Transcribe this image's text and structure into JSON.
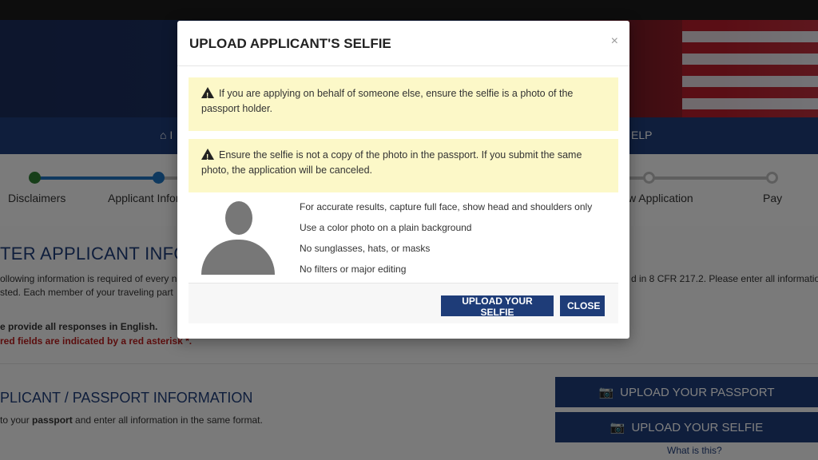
{
  "nav": {
    "home_fragment": "⌂ I",
    "help_fragment": "ELP"
  },
  "steps": [
    {
      "label": "Disclaimers"
    },
    {
      "label": "Applicant Infor"
    },
    {
      "label": "w Application"
    },
    {
      "label": "Pay"
    }
  ],
  "page": {
    "section_title": "TER APPLICANT INFOR",
    "para_line1": "ollowing information is required of every n",
    "para_line1_right": "d in 8 CFR 217.2. Please enter all information",
    "para_line2": "sted. Each member of your traveling part",
    "english_note": "e provide all responses in English.",
    "required_note": "red fields are indicated by a red asterisk *.",
    "sub_title": "PLICANT / PASSPORT INFORMATION",
    "sub_text_prefix": "to your ",
    "sub_text_bold": "passport",
    "sub_text_suffix": " and enter all information in the same format.",
    "upload_passport": "UPLOAD YOUR PASSPORT",
    "upload_selfie": "UPLOAD YOUR SELFIE",
    "what_is_this": "What is this?"
  },
  "modal": {
    "title": "UPLOAD APPLICANT'S SELFIE",
    "close_x": "×",
    "alert1_line1": "If you are applying on behalf of someone else, ensure the selfie is a photo of the",
    "alert1_line2": "passport holder.",
    "alert2_line1": "Ensure the selfie is not a copy of the photo in the passport. If you submit the same",
    "alert2_line2": "photo, the application will be canceled.",
    "tips": [
      "For accurate results, capture full face, show head and shoulders only",
      "Use a color photo on a plain background",
      "No sunglasses, hats, or masks",
      "No filters or major editing"
    ],
    "upload_button": "UPLOAD YOUR SELFIE",
    "close_button": "CLOSE"
  },
  "colors": {
    "brand": "#1e3c78",
    "alert_bg": "#fcf8c8",
    "asterisk": "#b71c1c"
  }
}
